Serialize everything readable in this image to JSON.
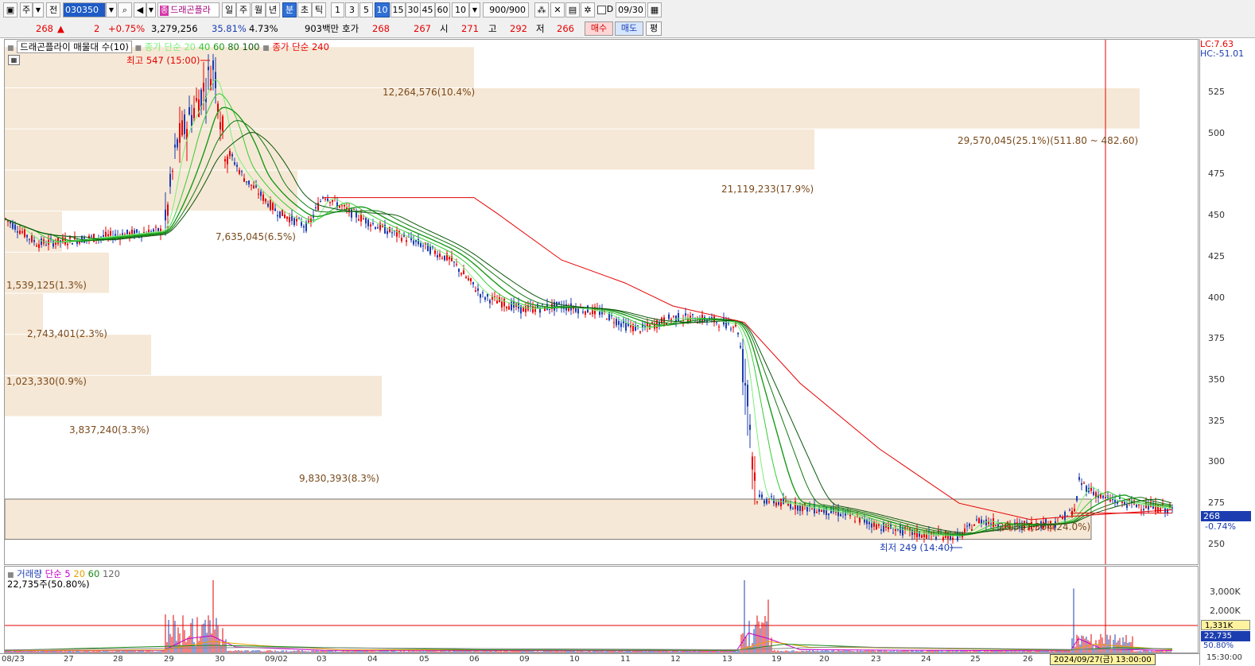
{
  "toolbar": {
    "market": "주",
    "jeon": "전",
    "code": "030350",
    "stock_name": "드래곤플라",
    "stock_icon": "종",
    "periods": [
      "일",
      "주",
      "월",
      "년",
      "분",
      "초",
      "틱"
    ],
    "minutes": [
      "1",
      "3",
      "5",
      "10",
      "15",
      "30",
      "45",
      "60"
    ],
    "selected_period": "분",
    "selected_minute": "10",
    "custom_minute": "10",
    "count": "900/900",
    "d_label": "D",
    "date_value": "09/30"
  },
  "quote": {
    "price": "268",
    "arrow": "▲",
    "change": "2",
    "change_pct": "+0.75%",
    "volume": "3,279,256",
    "vol_ratio": "35.81%",
    "turnover_pct": "4.73%",
    "amount": "903백만",
    "hoga_label": "호가",
    "ask": "268",
    "bid": "267",
    "open_label": "시",
    "open": "271",
    "high_label": "고",
    "high": "292",
    "low_label": "저",
    "low": "266",
    "buy_label": "매수",
    "sell_label": "매도",
    "eval_label": "평"
  },
  "price_panel": {
    "title": "드래곤플라이 매물대 수(10)",
    "legend_ma": [
      "종가 단순 20",
      "40",
      "60",
      "80",
      "100"
    ],
    "legend_ma240": "종가 단순 240",
    "high_marker": "최고 547 (15:00)",
    "low_marker": "최저 249 (14:40)",
    "lc": "LC:7.63",
    "hc": "HC:-51.01",
    "last_price_tag": "268",
    "last_change_tag": "-0.74%",
    "y_ticks": [
      "525",
      "500",
      "475",
      "450",
      "425",
      "400",
      "375",
      "350",
      "325",
      "300",
      "275",
      "250"
    ],
    "volume_profile": [
      {
        "label": "12,264,576(10.4%)"
      },
      {
        "label": "29,570,045(25.1%)(511.80 ~ 482.60)"
      },
      {
        "label": "21,119,233(17.9%)"
      },
      {
        "label": "7,635,045(6.5%)"
      },
      {
        "label": "1,539,125(1.3%)"
      },
      {
        "label": "2,743,401(2.3%)"
      },
      {
        "label": "1,023,330(0.9%)"
      },
      {
        "label": "3,837,240(3.3%)"
      },
      {
        "label": "9,830,393(8.3%)"
      },
      {
        "label": "28,317,364(24.0%)"
      }
    ],
    "colors": {
      "profile": "#f6e8d6",
      "candle_up": "#e60000",
      "candle_down": "#1b3db0",
      "ma240": "#e60000"
    }
  },
  "volume_panel": {
    "legend": [
      "거래량",
      "단순 5",
      "20",
      "60",
      "120"
    ],
    "current": "22,735주(50.80%)",
    "y_ticks": [
      "3,000K",
      "2,000K"
    ],
    "tag_1": "1,331K",
    "tag_2": "22,735",
    "tag_3": "50.80%"
  },
  "date_axis": {
    "labels": [
      "08/23",
      "27",
      "28",
      "29",
      "30",
      "09/02",
      "03",
      "04",
      "05",
      "06",
      "09",
      "10",
      "11",
      "12",
      "13",
      "19",
      "20",
      "23",
      "24",
      "25",
      "26"
    ],
    "cursor_label": "2024/09/27(금) 13:00:00",
    "right_label": "15:30:00"
  }
}
